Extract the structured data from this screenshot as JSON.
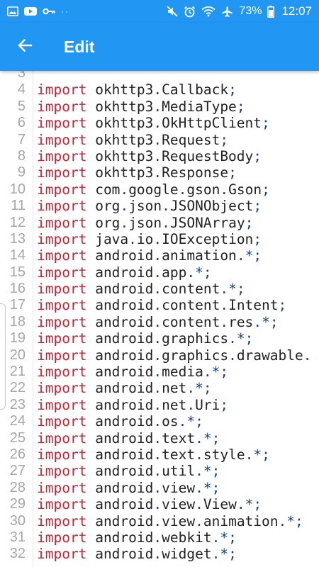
{
  "status_bar": {
    "icons_left": [
      "image-icon",
      "youtube-icon",
      "key-icon",
      "more-dots-icon"
    ],
    "icons_right": [
      "mute-icon",
      "alarm-icon",
      "wifi-icon",
      "airplane-icon"
    ],
    "battery": "73%",
    "time": "12:07"
  },
  "app_bar": {
    "title": "Edit",
    "back_icon": "arrow-left-icon"
  },
  "colors": {
    "app_bar": "#2196f3",
    "keyword": "#cc2233",
    "identifier": "#222222",
    "punctuation": "#1a3f8f",
    "line_number": "#a6a6a6"
  },
  "editor": {
    "lines": [
      {
        "n": "3",
        "text": ""
      },
      {
        "n": "4",
        "text": "import okhttp3.Callback;"
      },
      {
        "n": "5",
        "text": "import okhttp3.MediaType;"
      },
      {
        "n": "6",
        "text": "import okhttp3.OkHttpClient;"
      },
      {
        "n": "7",
        "text": "import okhttp3.Request;"
      },
      {
        "n": "8",
        "text": "import okhttp3.RequestBody;"
      },
      {
        "n": "9",
        "text": "import okhttp3.Response;"
      },
      {
        "n": "10",
        "text": "import com.google.gson.Gson;"
      },
      {
        "n": "11",
        "text": "import org.json.JSONObject;"
      },
      {
        "n": "12",
        "text": "import org.json.JSONArray;"
      },
      {
        "n": "13",
        "text": "import java.io.IOException;"
      },
      {
        "n": "14",
        "text": "import android.animation.*;"
      },
      {
        "n": "15",
        "text": "import android.app.*;"
      },
      {
        "n": "16",
        "text": "import android.content.*;"
      },
      {
        "n": "17",
        "text": "import android.content.Intent;"
      },
      {
        "n": "18",
        "text": "import android.content.res.*;"
      },
      {
        "n": "19",
        "text": "import android.graphics.*;"
      },
      {
        "n": "20",
        "text": "import android.graphics.drawable."
      },
      {
        "n": "21",
        "text": "import android.media.*;"
      },
      {
        "n": "22",
        "text": "import android.net.*;"
      },
      {
        "n": "23",
        "text": "import android.net.Uri;"
      },
      {
        "n": "24",
        "text": "import android.os.*;"
      },
      {
        "n": "25",
        "text": "import android.text.*;"
      },
      {
        "n": "26",
        "text": "import android.text.style.*;"
      },
      {
        "n": "27",
        "text": "import android.util.*;"
      },
      {
        "n": "28",
        "text": "import android.view.*;"
      },
      {
        "n": "29",
        "text": "import android.view.View.*;"
      },
      {
        "n": "30",
        "text": "import android.view.animation.*;"
      },
      {
        "n": "31",
        "text": "import android.webkit.*;"
      },
      {
        "n": "32",
        "text": "import android.widget.*;"
      }
    ]
  }
}
